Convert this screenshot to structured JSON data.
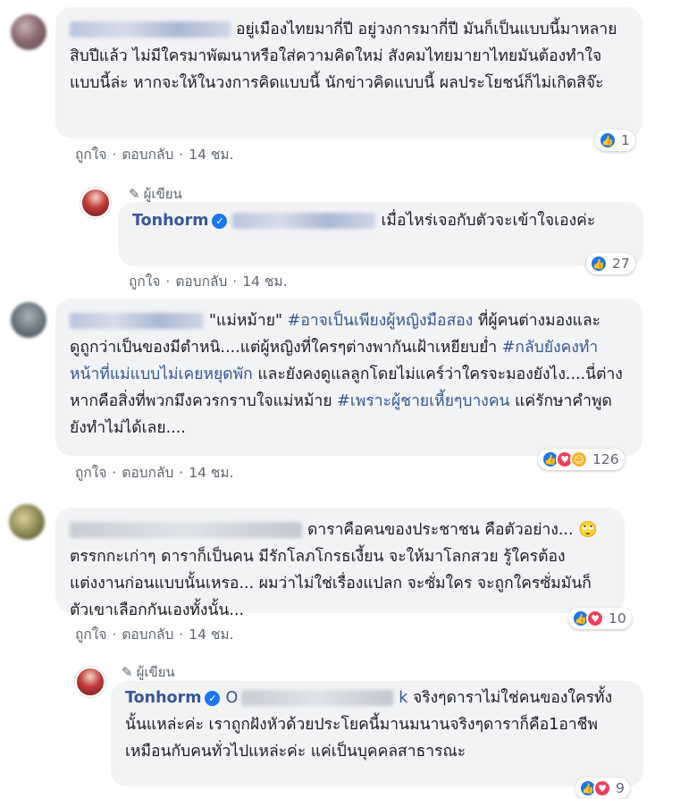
{
  "comments": [
    {
      "text": "อยู่เมืองไทยมากี่ปี อยู่วงการมากี่ปี มันก็เป็นแบบนี้มาหลายสิบปีแล้ว ไม่มีใครมาพัฒนาหรือใส่ความคิดใหม่ สังคมไทยมายาไทยมันต้องทำใจแบบนี้ล่ะ หากจะให้ในวงการคิดแบบนี้ นักข่าวคิดแบบนี้ ผลประโยชน์ก็ไม่เกิดสิจ๊ะ",
      "like": "ถูกใจ",
      "reply": "ตอบกลับ",
      "time": "14 ชม.",
      "reactions": "1"
    },
    {
      "author_label": "ผู้เขียน",
      "name": "Tonhorm",
      "text": "เมื่อไหร่เจอกับตัวจะเข้าใจเองค่ะ",
      "like": "ถูกใจ",
      "reply": "ตอบกลับ",
      "time": "14 ชม.",
      "reactions": "27"
    },
    {
      "quote": "\"แม่หม้าย\"",
      "tag1": "#อาจเป็นเพียงผู้หญิงมือสอง",
      "text1": " ที่ผู้คนต่างมองและดูถูกว่าเป็นของมีตำหนิ....แต่ผู้หญิงที่ใครๆต่างพากันเฝ้าเหยียบย่ำ ",
      "tag2": "#กลับยังคงทำหน้าที่แม่แบบไม่เคยหยุดพัก",
      "text2": " และยังคงดูแลลูกโดยไม่แคร์ว่าใครจะมองยังไง....นี่ต่างหากคือสิ่งที่พวกมึงควรกราบใจแม่หม้าย ",
      "tag3": "#เพราะผู้ชายเหี้ยๆบางคน",
      "text3": " แค่รักษาคำพูดยังทำไม่ได้เลย....",
      "like": "ถูกใจ",
      "reply": "ตอบกลับ",
      "time": "14 ชม.",
      "reactions": "126"
    },
    {
      "text1": "ดาราคือคนของประชาชน คือตัวอย่าง... ",
      "emoji": "🙄",
      "text2": " ตรรกกะเก่าๆ ดาราก็เป็นคน มีรักโลภโกรธเงี้ยน จะให้มาโลกสวย รู้ใครต้องแต่งงานก่อนแบบนั้นเหรอ... ผมว่าไม่ใช่เรื่องแปลก จะซั่มใคร จะถูกใครซั่มมันก็ตัวเขาเลือกกันเองทั้งนั้น...",
      "like": "ถูกใจ",
      "reply": "ตอบกลับ",
      "time": "14 ชม.",
      "reactions": "10"
    },
    {
      "author_label": "ผู้เขียน",
      "name": "Tonhorm",
      "mention_start": "O",
      "mention_end": "k",
      "text": " จริงๆดาราไม่ใช่คนของใครทั้งนั้นแหล่ะค่ะ เราถูกฝังหัวด้วยประโยคนี้มานมนานจริงๆดาราก็คือ1อาชีพเหมือนกับคนทั่วไปแหล่ะค่ะ แค่เป็นบุคคลสาธารณะ",
      "reactions": "9"
    }
  ]
}
